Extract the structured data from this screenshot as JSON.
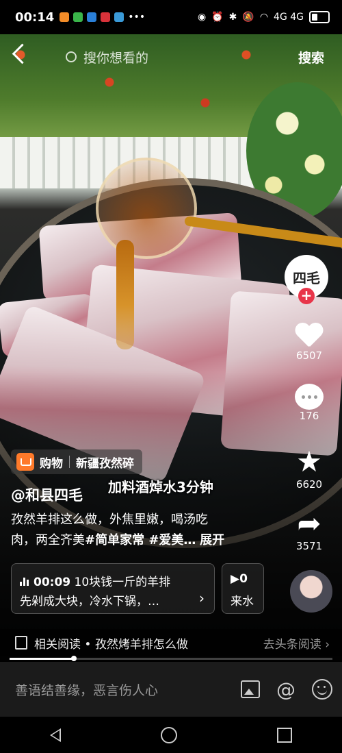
{
  "status_bar": {
    "time": "00:14",
    "app_icon_colors": [
      "#f28c28",
      "#3ab44a",
      "#2a7fd8",
      "#d8323a",
      "#3a9ad8"
    ],
    "more": "•••",
    "network": "4G 4G"
  },
  "top": {
    "search_placeholder": "搜你想看的",
    "search_button": "搜索"
  },
  "creator": {
    "avatar_text": "四毛"
  },
  "actions": {
    "likes": "6507",
    "comments": "176",
    "favorites": "6620",
    "shares": "3571"
  },
  "video": {
    "subtitle": "加料酒焯水3分钟",
    "shop_label": "购物",
    "shop_item": "新疆孜然碎",
    "author": "@和县四毛",
    "desc_line1": "孜然羊排这么做，外焦里嫩，喝汤吃",
    "desc_line2_prefix": "肉，两全齐美",
    "desc_tags": "#简单家常 #爱美…",
    "expand": "展开"
  },
  "series": {
    "time": "00:09",
    "title": "10块钱一斤的羊排",
    "line2": "先剁成大块，冷水下锅，…",
    "arrow": "›",
    "next_time": "▶0",
    "next_line2": "来水"
  },
  "related": {
    "text": "相关阅读 • 孜然烤羊排怎么做",
    "link": "去头条阅读 ›"
  },
  "progress": {
    "value_fraction": 0.2
  },
  "comment": {
    "placeholder": "善语结善缘，恶言伤人心"
  },
  "colors": {
    "like_accent": "#e8354a",
    "shop_orange": "#ff7a2a"
  }
}
